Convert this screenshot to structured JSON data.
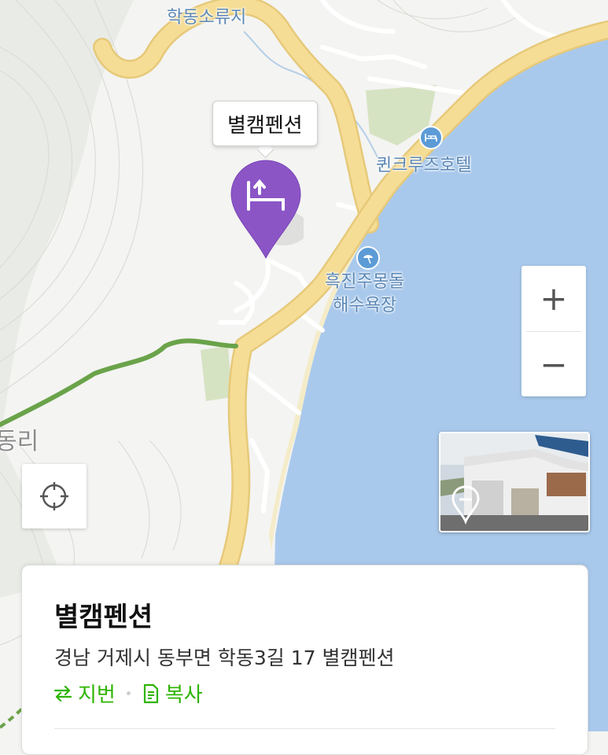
{
  "map": {
    "labels": {
      "reservoir": "학동소류지",
      "hotel": "퀸크루즈호텔",
      "beach": "흑진주몽돌\n해수욕장",
      "village": "동리"
    },
    "colors": {
      "sea": "#a9c9ec",
      "land": "#f4f4f2",
      "road": "#f6dd95",
      "road_edge": "#e6c97a",
      "trail": "#6aa34a",
      "park": "#d6e3c3",
      "sand": "#f4ecc9",
      "marker": "#8b55c6"
    }
  },
  "marker": {
    "callout_label": "별캠펜션",
    "icon": "bed-icon"
  },
  "controls": {
    "zoom_in": "+",
    "zoom_out": "−",
    "locate_icon": "crosshair-icon",
    "streetview_icon": "streetview-pin-icon"
  },
  "place_card": {
    "title": "별캠펜션",
    "address": "경남 거제시 동부면 학동3길 17 별캠펜션",
    "actions": [
      {
        "label": "지번",
        "icon": "swap-arrows-icon"
      },
      {
        "label": "복사",
        "icon": "copy-document-icon"
      }
    ],
    "accent": "#2db400"
  }
}
